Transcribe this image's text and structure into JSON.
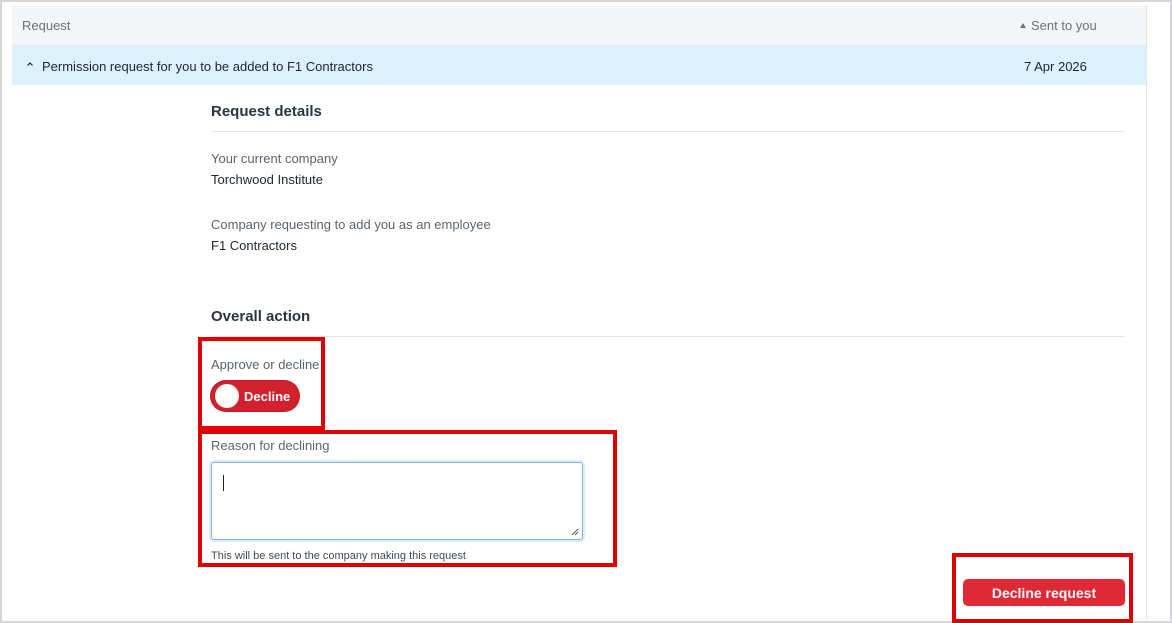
{
  "table": {
    "columns": {
      "request": "Request",
      "sent": "Sent to you"
    },
    "row": {
      "title": "Permission request for you to be added to F1 Contractors",
      "date": "7 Apr 2026"
    }
  },
  "details": {
    "heading": "Request details",
    "current_company_label": "Your current company",
    "current_company_value": "Torchwood Institute",
    "requesting_company_label": "Company requesting to add you as an employee",
    "requesting_company_value": "F1 Contractors"
  },
  "action": {
    "heading": "Overall action",
    "approve_label": "Approve or decline",
    "toggle_label": "Decline",
    "reason_label": "Reason for declining",
    "reason_value": "",
    "helper_text": "This will be sent to the company making this request",
    "submit_label": "Decline request"
  },
  "colors": {
    "accent_red": "#df2a36",
    "row_highlight": "#dcf1fb",
    "annotation_red": "#e10000"
  }
}
